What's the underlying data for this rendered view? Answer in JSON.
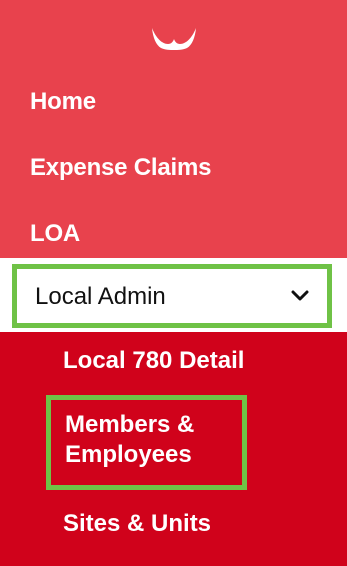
{
  "logo": {
    "icon": "brand-logo-icon"
  },
  "nav": {
    "home": "Home",
    "expense_claims": "Expense Claims",
    "loa": "LOA"
  },
  "dropdown": {
    "label": "Local Admin",
    "icon": "chevron-down-icon",
    "expanded": true
  },
  "submenu": {
    "items": [
      {
        "label": "Local 780 Detail"
      },
      {
        "label": "Members &",
        "label_line2": "Employees"
      },
      {
        "label": "Sites & Units"
      }
    ]
  },
  "colors": {
    "top_bg": "#e8424d",
    "submenu_bg": "#d0021b",
    "highlight": "#6fc246",
    "text": "#ffffff"
  }
}
